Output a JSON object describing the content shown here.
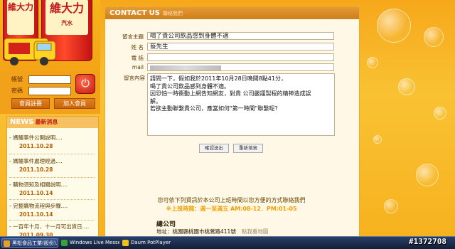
{
  "brand": {
    "can_text": "維大力",
    "can_sub": "汽水"
  },
  "login": {
    "account_label": "帳號",
    "password_label": "密碼",
    "register_label": "會員註冊",
    "join_label": "加入會員"
  },
  "news": {
    "title": "NEWS",
    "title_sub": "最新消息",
    "items": [
      {
        "title": "- 媽鱷事件公開說明....",
        "date": "2011.10.28"
      },
      {
        "title": "- 媽鱷事件處理經過....",
        "date": "2011.10.28"
      },
      {
        "title": "- 購物須知及相關說明....",
        "date": "2011.10.14"
      },
      {
        "title": "- 完整購物流程與步驟....",
        "date": "2011.10.14"
      },
      {
        "title": "- 一百年十月、十一月可出貨日....",
        "date": "2011.09.30"
      }
    ]
  },
  "contact": {
    "header": "CONTACT US",
    "header_zh": "聯絡我們",
    "subject_label": "留言主題",
    "subject_value": "喝了貴公司飲品感到身體不適",
    "name_label": "姓 名",
    "name_value": "蔡先生",
    "phone_label": "電 話",
    "phone_value": "",
    "mail_label": "mail",
    "mail_value": "",
    "message_label": "留言內容",
    "message_value": "請問一下，假如我於2011年10月28日晚間8點41分，\n喝了貴公司飲品感到身體不適。\n因恐怕一時衝動上網告知網友，對貴 公司嚴謹製程的精神造成誤\n解。\n若欲主動聯繫貴公司，應當如何\"第一時間\"聯繫呢?",
    "submit_label": "確認送出",
    "reset_label": "重新填寫"
  },
  "info": {
    "line1": "您可依下列資訊於本公司上班時間以您方便的方式聯絡我們",
    "hours": "※上班時間：週一至週五 AM:08-12．PM:01-05",
    "company": "總公司",
    "address": "地址：桃園縣桃園市桃鶯路411號",
    "map_link": "點我看地圖"
  },
  "taskbar": {
    "items": [
      {
        "label": "黑松食品工業(股份)...",
        "color": "#e8a020"
      },
      {
        "label": "Windows Live Messenger",
        "color": "#37a13a"
      },
      {
        "label": "Daum PotPlayer",
        "color": "#f0c020"
      }
    ]
  },
  "watermark": "#1372708"
}
